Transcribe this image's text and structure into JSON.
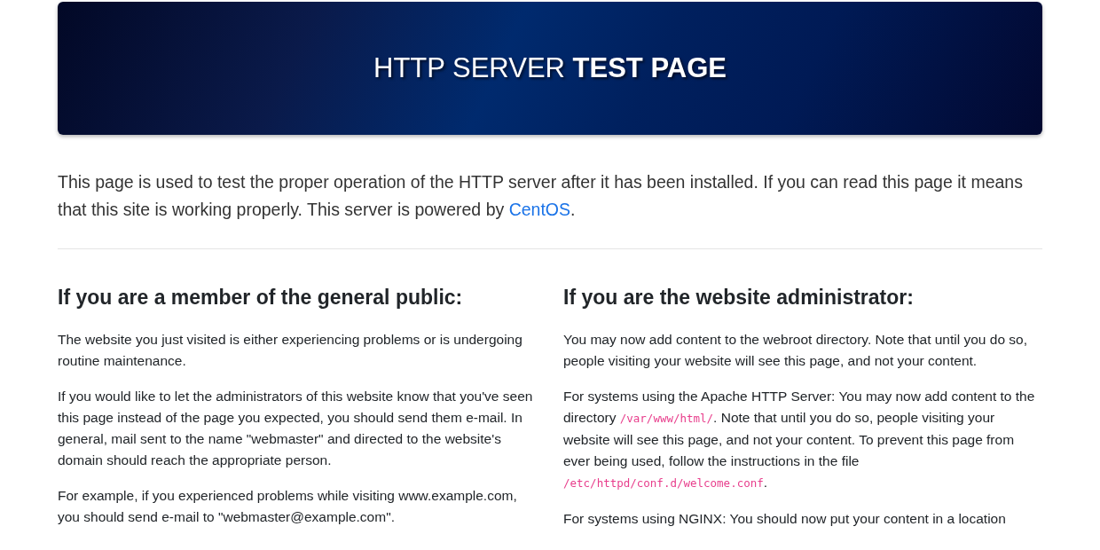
{
  "header": {
    "title": "HTTP SERVER **TEST PAGE**"
  },
  "intro": [
    {
      "kind": "text",
      "text": "This page is used to test the proper operation of the HTTP server after it has been installed. If you can read this page it means that this site is working properly. This server is powered by "
    },
    {
      "kind": "link",
      "text": "CentOS"
    },
    {
      "kind": "text",
      "text": "."
    }
  ],
  "columns": [
    {
      "heading": "If you are a member of the general public:",
      "paragraphs": [
        [
          {
            "kind": "text",
            "text": "The website you just visited is either experiencing problems or is undergoing routine maintenance."
          }
        ],
        [
          {
            "kind": "text",
            "text": "If you would like to let the administrators of this website know that you've seen this page instead of the page you expected, you should send them e-mail. In general, mail sent to the name \"webmaster\" and directed to the website's domain should reach the appropriate person."
          }
        ],
        [
          {
            "kind": "text",
            "text": "For example, if you experienced problems while visiting www.example.com, you should send e-mail to \"webmaster@example.com\"."
          }
        ]
      ]
    },
    {
      "heading": "If you are the website administrator:",
      "paragraphs": [
        [
          {
            "kind": "text",
            "text": "You may now add content to the webroot directory. Note that until you do so, people visiting your website will see this page, and not your content."
          }
        ],
        [
          {
            "kind": "text",
            "text": "For systems using the Apache HTTP Server: You may now add content to the directory "
          },
          {
            "kind": "code",
            "text": "/var/www/html/"
          },
          {
            "kind": "text",
            "text": ". Note that until you do so, people visiting your website will see this page, and not your content. To prevent this page from ever being used, follow the instructions in the file "
          },
          {
            "kind": "code",
            "text": "/etc/httpd/conf.d/welcome.conf"
          },
          {
            "kind": "text",
            "text": "."
          }
        ],
        [
          {
            "kind": "text",
            "text": "For systems using NGINX: You should now put your content in a location"
          }
        ]
      ]
    }
  ]
}
